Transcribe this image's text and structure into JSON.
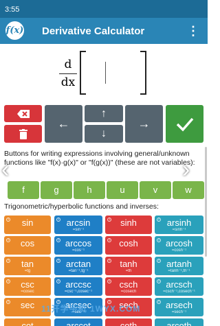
{
  "status": {
    "time": "3:55"
  },
  "app": {
    "title": "Derivative Calculator",
    "logo_text": "f(x)",
    "menu_icon": "more-vert-icon"
  },
  "editor": {
    "d_numerator": "d",
    "d_denominator": "dx"
  },
  "keypad": {
    "delete_icon": "backspace-icon",
    "clear_icon": "trash-icon",
    "left_icon": "arrow-left-icon",
    "up_icon": "arrow-up-icon",
    "down_icon": "arrow-down-icon",
    "right_icon": "arrow-right-icon",
    "confirm_icon": "checkmark-icon"
  },
  "sections": {
    "general_functions": "Buttons for writing expressions involving general/unknown functions like \"f(x)·g(x)\" or \"f(g(x))\" (these are not variables):",
    "trig": "Trigonometric/hyperbolic functions and inverses:"
  },
  "function_keys": [
    "f",
    "g",
    "h",
    "u",
    "v",
    "w"
  ],
  "trig_keys": [
    [
      {
        "main": "sin",
        "sub": ""
      },
      {
        "main": "arcsin",
        "sub": "=sin⁻¹"
      },
      {
        "main": "sinh",
        "sub": ""
      },
      {
        "main": "arsinh",
        "sub": "=sinh⁻¹"
      }
    ],
    [
      {
        "main": "cos",
        "sub": ""
      },
      {
        "main": "arccos",
        "sub": "=cos⁻¹"
      },
      {
        "main": "cosh",
        "sub": ""
      },
      {
        "main": "arcosh",
        "sub": "=cosh⁻¹"
      }
    ],
    [
      {
        "main": "tan",
        "sub": "=tg"
      },
      {
        "main": "arctan",
        "sub": "=tan⁻¹,tg⁻¹"
      },
      {
        "main": "tanh",
        "sub": "=th"
      },
      {
        "main": "artanh",
        "sub": "=tanh⁻¹,th⁻¹"
      }
    ],
    [
      {
        "main": "csc",
        "sub": "=cosec"
      },
      {
        "main": "arccsc",
        "sub": "=csc⁻¹,cosec⁻¹"
      },
      {
        "main": "csch",
        "sub": "=cosech"
      },
      {
        "main": "arcsch",
        "sub": "=csch⁻¹,cosech⁻¹"
      }
    ],
    [
      {
        "main": "sec",
        "sub": ""
      },
      {
        "main": "arcsec",
        "sub": "=sec⁻¹"
      },
      {
        "main": "sech",
        "sub": ""
      },
      {
        "main": "arsech",
        "sub": "=sech⁻¹"
      }
    ],
    [
      {
        "main": "cot",
        "sub": ""
      },
      {
        "main": "arccot",
        "sub": ""
      },
      {
        "main": "coth",
        "sub": ""
      },
      {
        "main": "arcoth",
        "sub": ""
      }
    ]
  ],
  "colors": {
    "orange": "#eb8a2a",
    "blue": "#1f7fc6",
    "red": "#dd3b3b",
    "teal": "#2aa1bb",
    "green": "#7ab54a",
    "appbar": "#2a85b6"
  },
  "watermark": "11开学手机 1WYX.COM"
}
